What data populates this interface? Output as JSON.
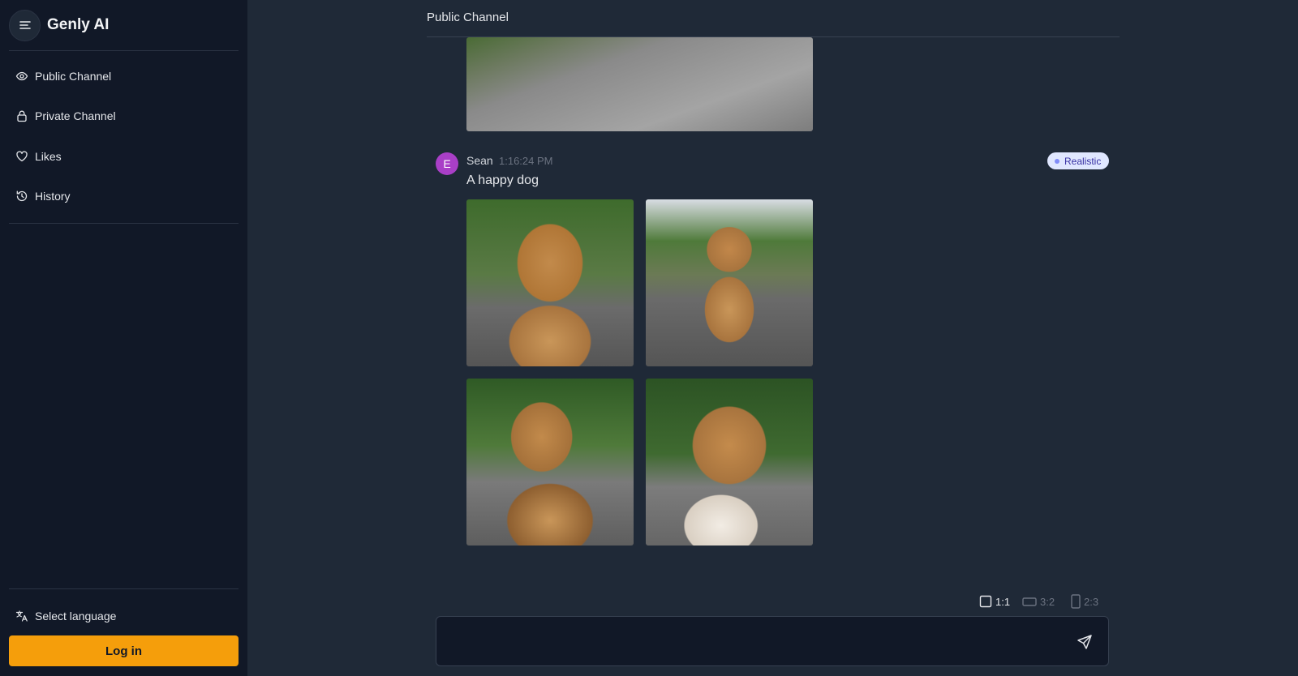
{
  "app": {
    "name": "Genly AI"
  },
  "sidebar": {
    "items": [
      {
        "label": "Public Channel",
        "icon": "eye-icon"
      },
      {
        "label": "Private Channel",
        "icon": "lock-icon"
      },
      {
        "label": "Likes",
        "icon": "heart-icon"
      },
      {
        "label": "History",
        "icon": "history-icon"
      }
    ],
    "language_label": "Select language",
    "login_label": "Log in"
  },
  "header": {
    "title": "Public Channel"
  },
  "message": {
    "avatar_letter": "E",
    "author": "Sean",
    "time": "1:16:24 PM",
    "prompt": "A happy dog",
    "style_badge": "Realistic"
  },
  "aspect_ratios": [
    {
      "label": "1:1",
      "selected": true
    },
    {
      "label": "3:2",
      "selected": false
    },
    {
      "label": "2:3",
      "selected": false
    }
  ],
  "composer": {
    "placeholder": "",
    "value": ""
  },
  "colors": {
    "sidebar_bg": "#111827",
    "main_bg": "#1f2937",
    "accent": "#f59e0b",
    "badge_bg": "#e0e7ff",
    "avatar_bg": "#a93fc7"
  }
}
